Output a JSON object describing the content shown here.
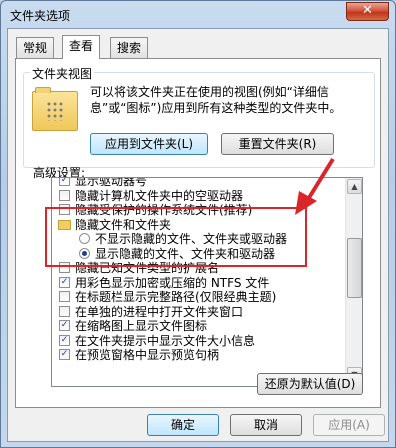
{
  "window": {
    "title": "文件夹选项",
    "close_glyph": "✕"
  },
  "tabs": [
    {
      "label": "常规",
      "active": false
    },
    {
      "label": "查看",
      "active": true
    },
    {
      "label": "搜索",
      "active": false
    }
  ],
  "folder_views": {
    "group_label": "文件夹视图",
    "description": "可以将该文件夹正在使用的视图(例如“详细信息”或“图标”)应用到所有这种类型的文件夹中。",
    "apply_button": "应用到文件夹(L)",
    "reset_button": "重置文件夹(R)"
  },
  "advanced": {
    "label": "高级设置:",
    "items": [
      {
        "type": "checkbox",
        "label": "显示驱动器号",
        "checked": true
      },
      {
        "type": "checkbox",
        "label": "隐藏计算机文件夹中的空驱动器",
        "checked": false
      },
      {
        "type": "checkbox",
        "label": "隐藏受保护的操作系统文件(推荐)",
        "checked": false
      },
      {
        "type": "folder",
        "label": "隐藏文件和文件夹"
      },
      {
        "type": "radio",
        "label": "不显示隐藏的文件、文件夹或驱动器",
        "checked": false
      },
      {
        "type": "radio",
        "label": "显示隐藏的文件、文件夹和驱动器",
        "checked": true
      },
      {
        "type": "checkbox",
        "label": "隐藏已知文件类型的扩展名",
        "checked": false
      },
      {
        "type": "checkbox",
        "label": "用彩色显示加密或压缩的 NTFS 文件",
        "checked": true
      },
      {
        "type": "checkbox",
        "label": "在标题栏显示完整路径(仅限经典主题)",
        "checked": false
      },
      {
        "type": "checkbox",
        "label": "在单独的进程中打开文件夹窗口",
        "checked": false
      },
      {
        "type": "checkbox",
        "label": "在缩略图上显示文件图标",
        "checked": true
      },
      {
        "type": "checkbox",
        "label": "在文件夹提示中显示文件大小信息",
        "checked": true
      },
      {
        "type": "checkbox",
        "label": "在预览窗格中显示预览句柄",
        "checked": true
      }
    ],
    "restore_button": "还原为默认值(D)"
  },
  "dialog_buttons": {
    "ok": "确定",
    "cancel": "取消",
    "apply": "应用(A)"
  },
  "colors": {
    "annotation": "#d9262a",
    "selection_blue": "#1c3f94"
  }
}
